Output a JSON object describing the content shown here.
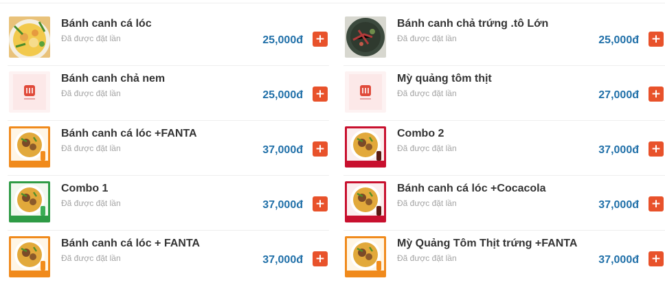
{
  "menu": {
    "ordered_label": "Đã được đặt lần",
    "add_icon": "plus-icon",
    "colors": {
      "price": "#1f6fa8",
      "add_button": "#e8522b",
      "name": "#333333",
      "muted": "#a3a3a3"
    },
    "left": [
      {
        "name": "Bánh canh cá lóc",
        "price": "25,000đ",
        "image": "noodle-bowl-photo"
      },
      {
        "name": "Bánh canh chả nem",
        "price": "25,000đ",
        "image": "placeholder-logo"
      },
      {
        "name": "Bánh canh cá lóc +FANTA",
        "price": "37,000đ",
        "image": "combo-fanta-photo"
      },
      {
        "name": "Combo 1",
        "price": "37,000đ",
        "image": "combo-sprite-photo"
      },
      {
        "name": "Bánh canh cá lóc + FANTA",
        "price": "37,000đ",
        "image": "combo-fanta-photo"
      }
    ],
    "right": [
      {
        "name": "Bánh canh chả trứng .tô Lớn",
        "price": "25,000đ",
        "image": "dark-bowl-photo"
      },
      {
        "name": "Mỳ quảng tôm thịt",
        "price": "27,000đ",
        "image": "placeholder-logo"
      },
      {
        "name": "Combo 2",
        "price": "37,000đ",
        "image": "combo-cocacola-photo"
      },
      {
        "name": "Bánh canh cá lóc +Cocacola",
        "price": "37,000đ",
        "image": "combo-cocacola-photo"
      },
      {
        "name": "Mỳ Quảng Tôm Thịt trứng +FANTA",
        "price": "37,000đ",
        "image": "combo-fanta-photo"
      }
    ]
  }
}
